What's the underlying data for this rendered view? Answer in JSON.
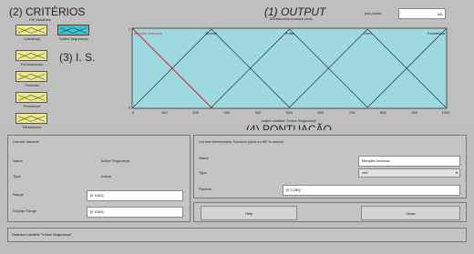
{
  "annotations": {
    "criterios": "(2) CRITÉRIOS",
    "output": "(1) OUTPUT",
    "is": "(3) I. S.",
    "pontuacao": "(4) PONTUAÇÃO"
  },
  "header": {
    "fis_variables": "FIS Variables",
    "membership_plots": "Membership function plots",
    "plot_points_label": "plot points:",
    "plot_points_value": "181"
  },
  "variables": [
    {
      "label": "Liderança"
    },
    {
      "label": "Índice Segurança"
    },
    {
      "label": "Fornecedores"
    },
    {
      "label": "Pessoas"
    },
    {
      "label": "Processos"
    },
    {
      "label": "Resultados"
    }
  ],
  "chart_data": {
    "type": "line",
    "xlabel": "output variable \"Índice Segurança\"",
    "xlim": [
      0,
      1000
    ],
    "ylim": [
      0,
      1
    ],
    "x_ticks": [
      "0",
      "100",
      "200",
      "300",
      "400",
      "500",
      "600",
      "700",
      "800",
      "900",
      "1000"
    ],
    "y_ticks": [
      "0",
      "1"
    ],
    "series": [
      {
        "name": "Menção Honrosa",
        "points": [
          [
            0,
            1
          ],
          [
            250,
            0
          ]
        ],
        "color": "#d9303a"
      },
      {
        "name": "Bronze",
        "points": [
          [
            0,
            0
          ],
          [
            250,
            1
          ],
          [
            500,
            0
          ]
        ],
        "color": "#2b2b2b"
      },
      {
        "name": "Prata",
        "points": [
          [
            250,
            0
          ],
          [
            500,
            1
          ],
          [
            750,
            0
          ]
        ],
        "color": "#2b2b2b"
      },
      {
        "name": "Ouro",
        "points": [
          [
            500,
            0
          ],
          [
            750,
            1
          ],
          [
            1000,
            0
          ]
        ],
        "color": "#2b2b2b"
      },
      {
        "name": "Excelência",
        "points": [
          [
            750,
            0
          ],
          [
            1000,
            1
          ]
        ],
        "color": "#2b2b2b"
      }
    ]
  },
  "current_variable": {
    "title": "Current Variable",
    "name_label": "Name",
    "name_value": "Índice Segurança",
    "type_label": "Type",
    "type_value": "output",
    "range_label": "Range",
    "range_value": "[0 1000]",
    "display_range_label": "Display Range",
    "display_range_value": "[0 1000]"
  },
  "current_mf": {
    "title": "Current Membership Function (click on MF to select)",
    "name_label": "Name",
    "name_value": "Menção Honrosa",
    "type_label": "Type",
    "type_value": "zmf",
    "params_label": "Params",
    "params_value": "[0 0 250]"
  },
  "buttons": {
    "help": "Help",
    "close": "Close"
  },
  "status": "Selected variable \"Índice Segurança\""
}
